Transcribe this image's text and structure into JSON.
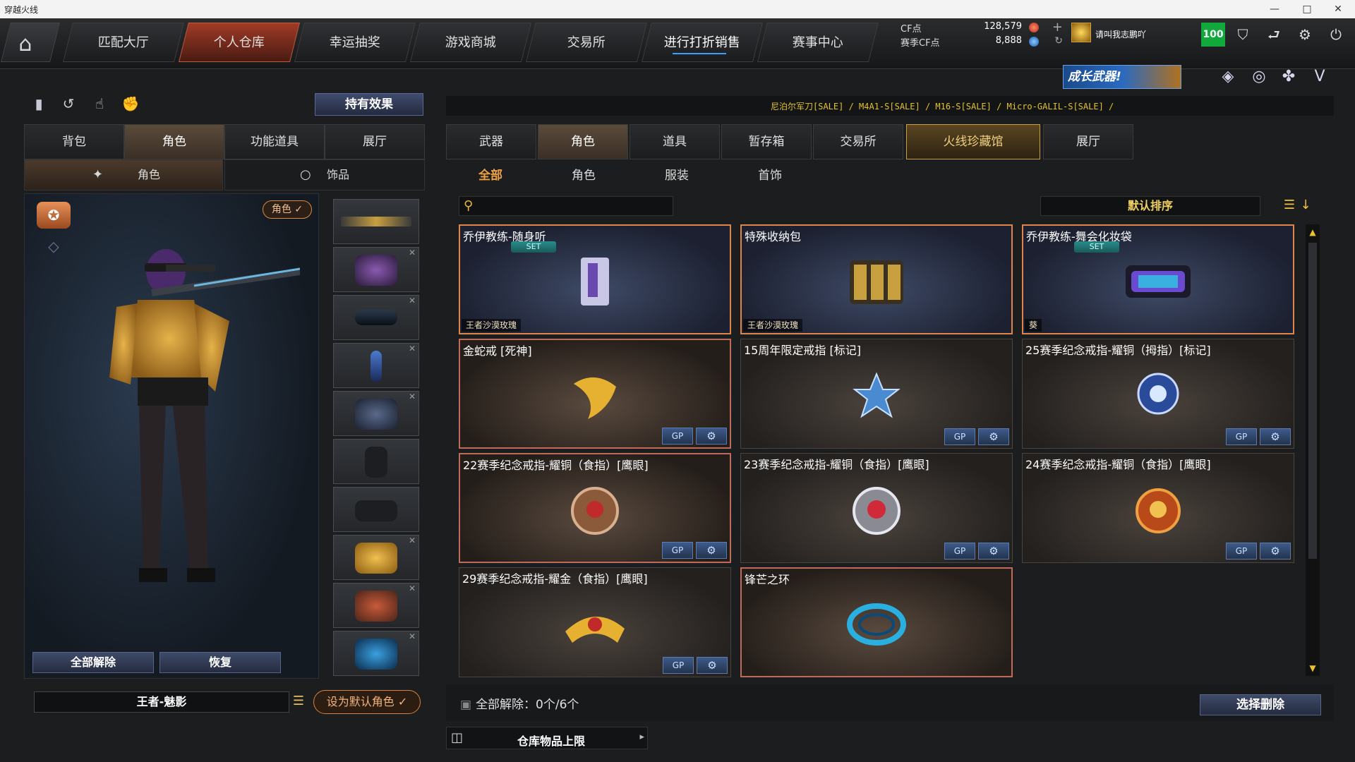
{
  "window": {
    "title": "穿越火线",
    "controls": [
      "—",
      "□",
      "✕"
    ]
  },
  "topnav": {
    "home_icon": "home-icon",
    "tabs": [
      {
        "label": "匹配大厅"
      },
      {
        "label": "个人仓库",
        "active": true
      },
      {
        "label": "幸运抽奖"
      },
      {
        "label": "游戏商城"
      },
      {
        "label": "交易所"
      },
      {
        "label": "进行打折销售"
      },
      {
        "label": "赛事中心"
      }
    ],
    "currency": {
      "cf_label": "CF点",
      "cf_value": "128,579",
      "event_label": "赛季CF点",
      "event_value": "8,888"
    },
    "username": "请叫我志鹏吖",
    "level": "100",
    "icons": [
      "shield-icon",
      "exit-icon",
      "settings-gear-icon",
      "power-icon"
    ]
  },
  "left": {
    "hold_effect": "持有效果",
    "tabs": [
      {
        "label": "背包"
      },
      {
        "label": "角色",
        "active": true
      },
      {
        "label": "功能道具"
      },
      {
        "label": "展厅"
      }
    ],
    "subtabs": [
      {
        "label": "角色",
        "active": true
      },
      {
        "label": "饰品"
      }
    ],
    "role_badge": "角色 ✓",
    "release_all": "全部解除",
    "restore": "恢复",
    "role_name": "王者-魅影",
    "set_default": "设为默认角色 ✓"
  },
  "right": {
    "ticker": "尼泊尔军刀[SALE] / M4A1-S[SALE] / M16-S[SALE] / Micro-GALIL-S[SALE] /",
    "promo": "成长武器!",
    "tabs": [
      {
        "label": "武器"
      },
      {
        "label": "角色",
        "active": true
      },
      {
        "label": "道具"
      },
      {
        "label": "暂存箱"
      },
      {
        "label": "交易所"
      },
      {
        "label": "火线珍藏馆",
        "gold": true
      },
      {
        "label": "展厅"
      }
    ],
    "subtabs": [
      {
        "label": "全部",
        "active": true
      },
      {
        "label": "角色"
      },
      {
        "label": "服装"
      },
      {
        "label": "首饰"
      }
    ],
    "search_placeholder": "",
    "sort_label": "默认排序",
    "items": [
      {
        "name": "乔伊教练-随身听",
        "set": "SET",
        "owner": "王者沙漠玫瑰"
      },
      {
        "name": "特殊收纳包",
        "owner": "王者沙漠玫瑰"
      },
      {
        "name": "乔伊教练-舞会化妆袋",
        "set": "SET",
        "owner": "葵"
      },
      {
        "name": "金蛇戒 [死神]",
        "gp": "GP"
      },
      {
        "name": "15周年限定戒指 [标记]",
        "gp": "GP"
      },
      {
        "name": "25赛季纪念戒指-耀铜（拇指）[标记]",
        "gp": "GP"
      },
      {
        "name": "22赛季纪念戒指-耀铜（食指）[鹰眼]",
        "gp": "GP"
      },
      {
        "name": "23赛季纪念戒指-耀铜（食指）[鹰眼]",
        "gp": "GP"
      },
      {
        "name": "24赛季纪念戒指-耀铜（食指）[鹰眼]",
        "gp": "GP"
      },
      {
        "name": "29赛季纪念戒指-耀金（食指）[鹰眼]",
        "gp": "GP"
      },
      {
        "name": "锋芒之环"
      }
    ],
    "release_all_info": "全部解除：0个/6个",
    "select_delete": "选择删除",
    "capacity": "仓库物品上限"
  },
  "colors": {
    "accent": "#e0854a",
    "active_tab": "#a03a26",
    "gold": "#e2c22a",
    "level_green": "#11a83c"
  }
}
